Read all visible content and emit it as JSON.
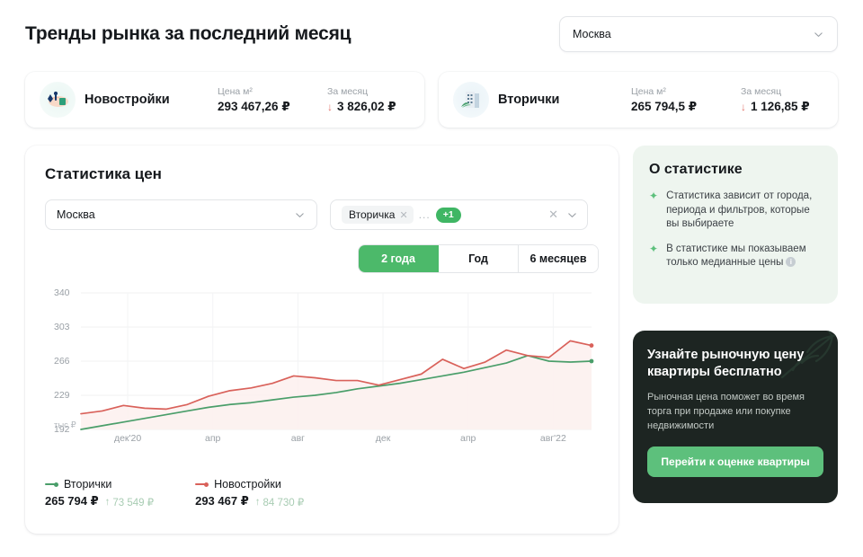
{
  "header": {
    "title": "Тренды рынка за последний месяц",
    "city_select": {
      "value": "Москва",
      "icon": "chevron-down-icon"
    }
  },
  "summary_cards": [
    {
      "icon": "house-keys-icon",
      "name": "Новостройки",
      "price_label": "Цена м²",
      "price_value": "293 467,26 ₽",
      "month_label": "За месяц",
      "month_arrow": "↓",
      "month_value": "3 826,02 ₽"
    },
    {
      "icon": "building-icon",
      "name": "Вторички",
      "price_label": "Цена м²",
      "price_value": "265 794,5 ₽",
      "month_label": "За месяц",
      "month_arrow": "↓",
      "month_value": "1 126,85 ₽"
    }
  ],
  "chart_card": {
    "title": "Статистика цен",
    "city_filter": {
      "value": "Москва"
    },
    "type_filter": {
      "chip": "Вторичка",
      "dots": "...",
      "more_badge": "+1"
    },
    "periods": [
      {
        "label": "2 года",
        "active": true
      },
      {
        "label": "Год",
        "active": false
      },
      {
        "label": "6 месяцев",
        "active": false
      }
    ],
    "y_unit": "тыс ₽",
    "legend": [
      {
        "name": "Вторички",
        "color": "#4a9e6a",
        "value": "265 794 ₽",
        "delta_arrow": "↑",
        "delta": "73 549 ₽"
      },
      {
        "name": "Новостройки",
        "color": "#d9615a",
        "value": "293 467 ₽",
        "delta_arrow": "↑",
        "delta": "84 730 ₽"
      }
    ]
  },
  "chart_data": {
    "type": "line",
    "title": "Статистика цен",
    "xlabel": "",
    "ylabel": "тыс ₽",
    "ylim": [
      192,
      340
    ],
    "yticks": [
      340,
      303,
      266,
      229,
      192
    ],
    "y_unit": "тыс ₽",
    "grid": true,
    "legend_position": "bottom-left",
    "x": [
      "дек'20",
      "апр",
      "авг",
      "дек",
      "апр",
      "авг'22"
    ],
    "xticks": [
      "дек'20",
      "апр",
      "авг",
      "дек",
      "апр",
      "авг'22"
    ],
    "series": [
      {
        "name": "Новостройки",
        "color": "#d9615a",
        "fill": "#fdf0ef",
        "values": [
          209,
          212,
          218,
          215,
          214,
          219,
          228,
          234,
          237,
          242,
          250,
          248,
          245,
          245,
          240,
          246,
          252,
          268,
          258,
          265,
          278,
          272,
          270,
          288,
          283
        ]
      },
      {
        "name": "Вторички",
        "color": "#4a9e6a",
        "fill": "#f4f7f4",
        "values": [
          192,
          196,
          200,
          204,
          208,
          212,
          216,
          219,
          221,
          224,
          227,
          229,
          232,
          236,
          239,
          242,
          246,
          250,
          254,
          259,
          264,
          272,
          266,
          265,
          266
        ]
      }
    ],
    "last_point_markers": true
  },
  "info_panel": {
    "title": "О статистике",
    "items": [
      {
        "bullet": "sparkle-icon",
        "text": "Статистика зависит от города, периода и фильтров, которые вы выбираете",
        "has_help": false
      },
      {
        "bullet": "sparkle-icon",
        "text": "В статистике мы показываем только медианные цены",
        "has_help": true,
        "help_glyph": "i"
      }
    ]
  },
  "promo": {
    "title": "Узнайте рыночную цену квартиры бесплатно",
    "subtitle": "Рыночная цена поможет во время торга при продаже или покупке недвижимости",
    "button_label": "Перейти к оценке квартиры",
    "accent": "#5dc07c",
    "background": "#1d2522"
  }
}
